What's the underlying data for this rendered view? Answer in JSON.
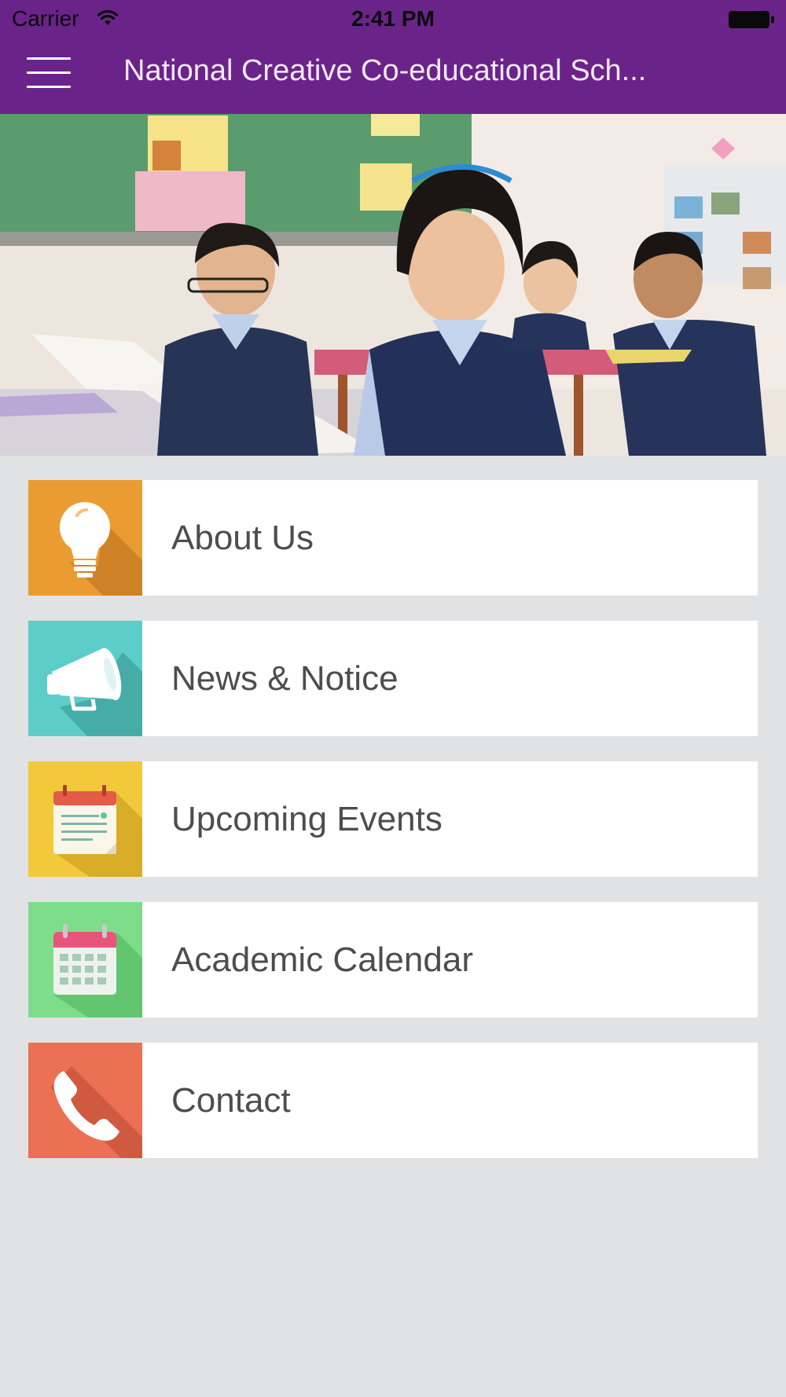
{
  "status_bar": {
    "carrier": "Carrier",
    "time": "2:41 PM",
    "wifi_icon": "wifi-icon",
    "battery_icon": "battery-icon"
  },
  "nav_bar": {
    "title": "National Creative Co-educational Sch...",
    "menu_icon": "hamburger-menu-icon",
    "background_color": "#6a2489"
  },
  "hero": {
    "image": "classroom-students-reading-photo"
  },
  "menu": {
    "items": [
      {
        "label": "About Us",
        "icon": "lightbulb-icon",
        "color": "#ea9c33"
      },
      {
        "label": "News & Notice",
        "icon": "megaphone-icon",
        "color": "#5ccdc8"
      },
      {
        "label": "Upcoming Events",
        "icon": "notepad-calendar-icon",
        "color": "#f1c93b"
      },
      {
        "label": "Academic Calendar",
        "icon": "calendar-grid-icon",
        "color": "#7ddd8a"
      },
      {
        "label": "Contact",
        "icon": "phone-icon",
        "color": "#ec7053"
      }
    ]
  }
}
